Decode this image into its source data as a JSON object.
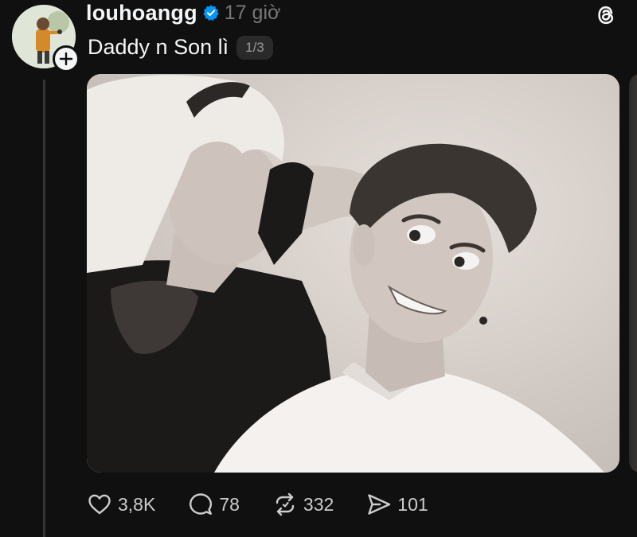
{
  "post": {
    "username": "louhoangg",
    "time": "17 giờ",
    "caption": "Daddy n Son lì",
    "page_indicator": "1/3",
    "verified": true
  },
  "icons": {
    "avatar": "avatar-photo",
    "follow": "plus-icon",
    "verified": "verified-badge-icon",
    "app": "threads-logo-icon",
    "like": "heart-icon",
    "comment": "comment-bubble-icon",
    "repost": "repost-icon",
    "share": "send-icon"
  },
  "actions": {
    "likes": "3,8K",
    "comments": "78",
    "reposts": "332",
    "shares": "101"
  },
  "colors": {
    "background": "#101010",
    "text_primary": "#f3f5f7",
    "text_secondary": "#777777",
    "verified_blue": "#0095f6",
    "thread_line": "#333638"
  }
}
